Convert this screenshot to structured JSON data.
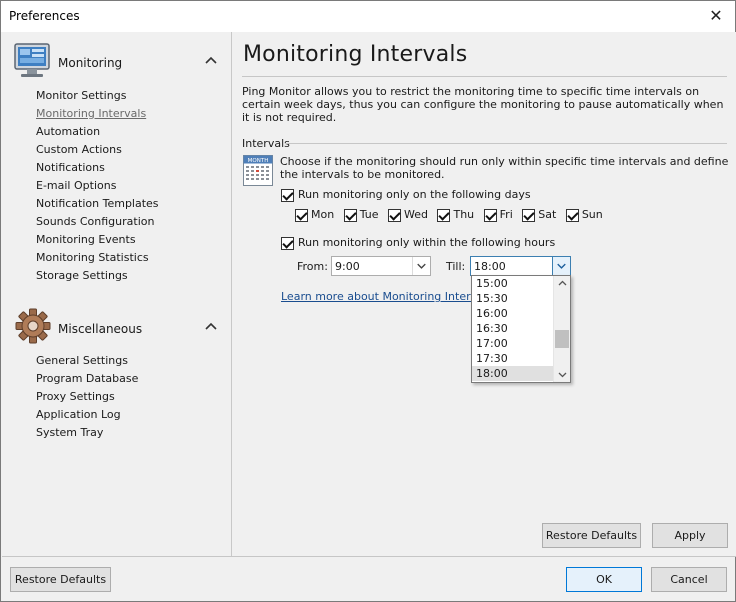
{
  "window": {
    "title": "Preferences",
    "close_glyph": "✕"
  },
  "sidebar": {
    "groups": [
      {
        "label": "Monitoring",
        "icon": "monitor-icon",
        "items": [
          {
            "label": "Monitor Settings"
          },
          {
            "label": "Monitoring Intervals",
            "selected": true
          },
          {
            "label": "Automation"
          },
          {
            "label": "Custom Actions"
          },
          {
            "label": "Notifications"
          },
          {
            "label": "E-mail Options"
          },
          {
            "label": "Notification Templates"
          },
          {
            "label": "Sounds Configuration"
          },
          {
            "label": "Monitoring Events"
          },
          {
            "label": "Monitoring Statistics"
          },
          {
            "label": "Storage Settings"
          }
        ]
      },
      {
        "label": "Miscellaneous",
        "icon": "gear-icon",
        "items": [
          {
            "label": "General Settings"
          },
          {
            "label": "Program Database"
          },
          {
            "label": "Proxy Settings"
          },
          {
            "label": "Application Log"
          },
          {
            "label": "System Tray"
          }
        ]
      }
    ]
  },
  "main": {
    "title": "Monitoring Intervals",
    "description": "Ping Monitor allows you to restrict the monitoring time to specific time intervals on certain week days, thus you can configure the monitoring to pause automatically when it is not required.",
    "section_label": "Intervals",
    "calendar_icon_text": "MONTH",
    "intro": "Choose if the monitoring should run only within specific time intervals and define the intervals to be monitored.",
    "days_checkbox": {
      "label": "Run monitoring only on the following days",
      "checked": true
    },
    "days": [
      {
        "label": "Mon",
        "checked": true
      },
      {
        "label": "Tue",
        "checked": true
      },
      {
        "label": "Wed",
        "checked": true
      },
      {
        "label": "Thu",
        "checked": true
      },
      {
        "label": "Fri",
        "checked": true
      },
      {
        "label": "Sat",
        "checked": true
      },
      {
        "label": "Sun",
        "checked": true
      }
    ],
    "hours_checkbox": {
      "label": "Run monitoring only within the following hours",
      "checked": true
    },
    "from_label": "From:",
    "from_value": "9:00",
    "till_label": "Till:",
    "till_value": "18:00",
    "till_options_visible": [
      "15:00",
      "15:30",
      "16:00",
      "16:30",
      "17:00",
      "17:30",
      "18:00"
    ],
    "till_selected": "18:00",
    "learn_more_link": "Learn more about Monitoring Interva",
    "restore_defaults_label": "Restore Defaults",
    "apply_label": "Apply"
  },
  "footer": {
    "restore_defaults_label": "Restore Defaults",
    "ok_label": "OK",
    "cancel_label": "Cancel"
  },
  "colors": {
    "accent": "#0078d7",
    "link": "#1a4d8f",
    "panel_bg": "#f0f0f0"
  }
}
